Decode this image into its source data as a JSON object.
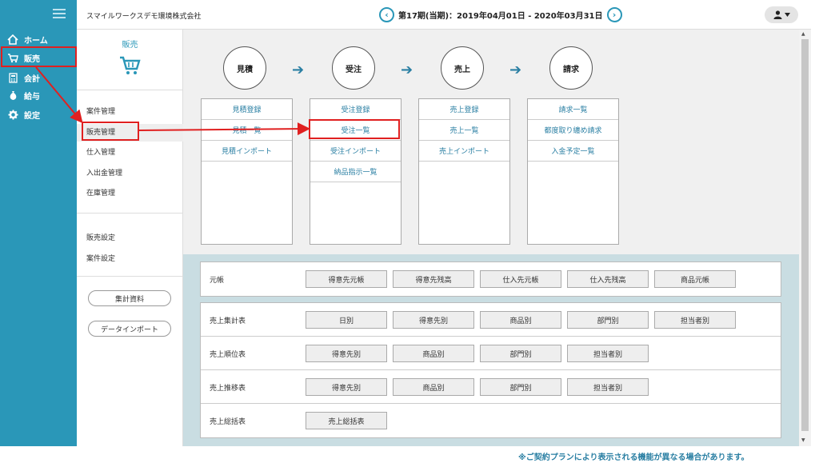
{
  "header": {
    "company": "スマイルワークスデモ環境株式会社",
    "period": "第17期(当期)：2019年04月01日 - 2020年03月31日",
    "prev_icon": "‹",
    "next_icon": "›"
  },
  "leftnav": {
    "items": [
      {
        "label": "ホーム",
        "icon": "home-icon"
      },
      {
        "label": "販売",
        "icon": "cart-icon"
      },
      {
        "label": "会計",
        "icon": "calculator-icon"
      },
      {
        "label": "給与",
        "icon": "money-bag-icon"
      },
      {
        "label": "設定",
        "icon": "gear-icon"
      }
    ]
  },
  "subnav": {
    "title": "販売",
    "items": [
      "案件管理",
      "販売管理",
      "仕入管理",
      "入出金管理",
      "在庫管理"
    ],
    "settings": [
      "販売設定",
      "案件設定"
    ],
    "buttons": [
      "集計資料",
      "データインポート"
    ]
  },
  "flow": {
    "steps": [
      "見積",
      "受注",
      "売上",
      "請求"
    ],
    "columns": [
      [
        "見積登録",
        "見積一覧",
        "見積インポート"
      ],
      [
        "受注登録",
        "受注一覧",
        "受注インポート",
        "納品指示一覧"
      ],
      [
        "売上登録",
        "売上一覧",
        "売上インポート"
      ],
      [
        "請求一覧",
        "都度取り纏め請求",
        "入金予定一覧"
      ]
    ]
  },
  "reports": {
    "ledger": {
      "label": "元帳",
      "buttons": [
        "得意先元帳",
        "得意先残高",
        "仕入先元帳",
        "仕入先残高",
        "商品元帳"
      ]
    },
    "rows": [
      {
        "label": "売上集計表",
        "buttons": [
          "日別",
          "得意先別",
          "商品別",
          "部門別",
          "担当者別"
        ]
      },
      {
        "label": "売上順位表",
        "buttons": [
          "得意先別",
          "商品別",
          "部門別",
          "担当者別"
        ]
      },
      {
        "label": "売上推移表",
        "buttons": [
          "得意先別",
          "商品別",
          "部門別",
          "担当者別"
        ]
      },
      {
        "label": "売上総括表",
        "buttons": [
          "売上総括表"
        ]
      }
    ]
  },
  "footnote": "※ご契約プランにより表示される機能が異なる場合があります。",
  "colors": {
    "accent": "#2a97b8",
    "annotation": "#e02020"
  }
}
